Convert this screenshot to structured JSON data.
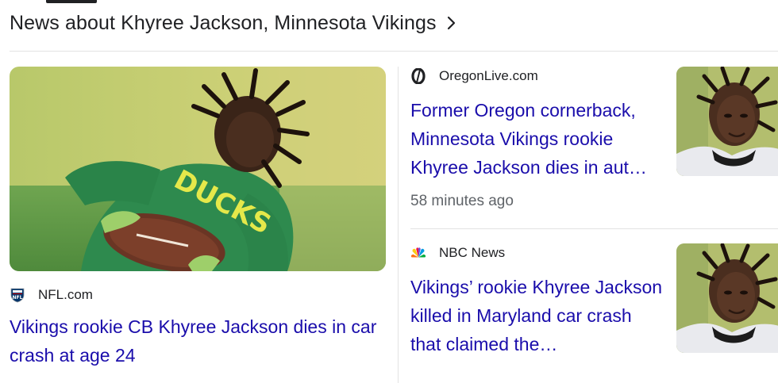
{
  "header": {
    "title": "News about Khyree Jackson, Minnesota Vikings"
  },
  "lead": {
    "source": "NFL.com",
    "headline": "Vikings rookie CB Khyree Jackson dies in car crash at age 24",
    "jersey_text": "DUCKS"
  },
  "cards": [
    {
      "source": "OregonLive.com",
      "headline": "Former Oregon cornerback, Minnesota Vikings rookie Khyree Jackson dies in aut…",
      "time": "58 minutes ago"
    },
    {
      "source": "NBC News",
      "headline": "Vikings’ rookie Khyree Jackson killed in Maryland car crash that claimed the…"
    }
  ],
  "colors": {
    "link": "#1a0dab",
    "text": "#202124",
    "meta": "#5f6368",
    "divider": "#e3e3e3"
  },
  "icons": {
    "header_chevron": "chevron-right-icon",
    "nfl_favicon": "nfl-shield-icon",
    "oregonlive_favicon": "oregonlive-o-icon",
    "nbc_favicon": "nbc-peacock-icon"
  }
}
